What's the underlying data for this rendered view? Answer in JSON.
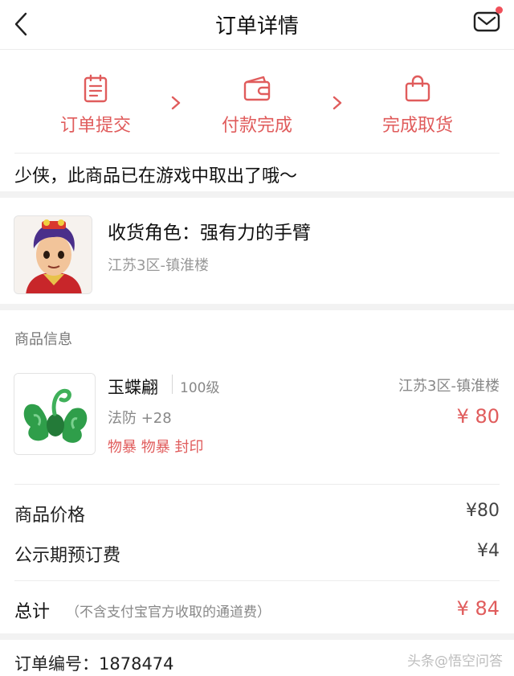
{
  "header": {
    "title": "订单详情",
    "back_icon": "chevron-left-icon",
    "mail_icon": "mail-icon"
  },
  "steps": [
    {
      "label": "订单提交",
      "icon": "document-icon"
    },
    {
      "label": "付款完成",
      "icon": "wallet-icon"
    },
    {
      "label": "完成取货",
      "icon": "bag-icon"
    }
  ],
  "notice": "少侠，此商品已在游戏中取出了哦～",
  "role": {
    "title": "收货角色：强有力的手臂",
    "server": "江苏3区-镇淮楼"
  },
  "goods": {
    "section_title": "商品信息",
    "item": {
      "name": "玉蝶翩",
      "level": "100级",
      "stat": "法防 +28",
      "tags": "物暴 物暴 封印",
      "server": "江苏3区-镇淮楼",
      "price": "¥ 80"
    }
  },
  "fees": [
    {
      "label": "商品价格",
      "value": "¥80"
    },
    {
      "label": "公示期预订费",
      "value": "¥4"
    }
  ],
  "total": {
    "label": "总计",
    "note": "（不含支付宝官方收取的通道费）",
    "value": "¥ 84"
  },
  "order": {
    "label": "订单编号：1878474",
    "watermark": "头条@悟空问答"
  },
  "colors": {
    "accent": "#e05c5c",
    "divider": "#ececec",
    "gap": "#f2f2f2"
  }
}
